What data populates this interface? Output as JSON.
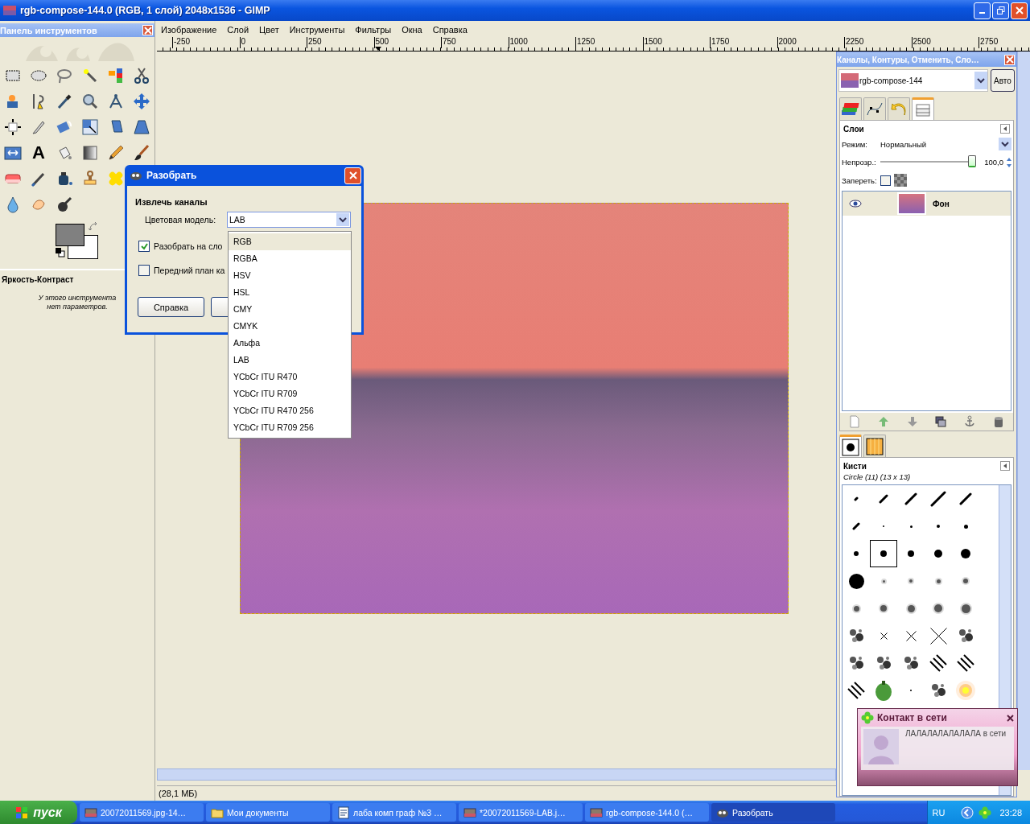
{
  "window": {
    "title": "rgb-compose-144.0 (RGB, 1 слой) 2048x1536 - GIMP"
  },
  "toolbox": {
    "title": "Панель инструментов",
    "text_glyph": "A",
    "options_title": "Яркость-Контраст",
    "options_note": "У этого инструмента нет параметров."
  },
  "menu": [
    "Изображение",
    "Слой",
    "Цвет",
    "Инструменты",
    "Фильтры",
    "Окна",
    "Справка"
  ],
  "ruler": [
    "-250",
    "0",
    "250",
    "500",
    "750",
    "1000",
    "1250",
    "1500",
    "1750",
    "2000",
    "2250",
    "2500",
    "2750"
  ],
  "status_bar": "(28,1 МБ)",
  "dialog": {
    "title": "Разобрать",
    "section": "Извлечь каналы",
    "model_label": "Цветовая модель:",
    "model_value": "LAB",
    "options": [
      {
        "label": "Разобрать на сло",
        "checked": true
      },
      {
        "label": "Передний план ка",
        "checked": false
      }
    ],
    "help_button": "Справка"
  },
  "dropdown": [
    {
      "label": "RGB",
      "highlighted": true
    },
    {
      "label": "RGBA",
      "highlighted": false
    },
    {
      "label": "HSV",
      "highlighted": false
    },
    {
      "label": "HSL",
      "highlighted": false
    },
    {
      "label": "CMY",
      "highlighted": false
    },
    {
      "label": "CMYK",
      "highlighted": false
    },
    {
      "label": "Альфа",
      "highlighted": false
    },
    {
      "label": "LAB",
      "highlighted": false
    },
    {
      "label": "YCbCr ITU R470",
      "highlighted": false
    },
    {
      "label": "YCbCr ITU R709",
      "highlighted": false
    },
    {
      "label": "YCbCr ITU R470 256",
      "highlighted": false
    },
    {
      "label": "YCbCr ITU R709 256",
      "highlighted": false
    }
  ],
  "dock": {
    "title": "Каналы, Контуры, Отменить, Сло…",
    "image": "rgb-compose-144",
    "auto_button": "Авто",
    "tabs": [
      {
        "kind": "channels",
        "selected": false
      },
      {
        "kind": "paths",
        "selected": false
      },
      {
        "kind": "undo",
        "selected": false
      },
      {
        "kind": "layers",
        "selected": true
      }
    ],
    "layers": {
      "title": "Слои",
      "mode_label": "Режим:",
      "mode": "Нормальный",
      "opacity_label": "Непрозр.:",
      "opacity": {
        "level": 1.0,
        "reading": "100,0"
      },
      "lock_label": "Запереть:",
      "lock_checked": false,
      "items": [
        {
          "name": "Фон",
          "visible": true,
          "selected": true
        }
      ]
    },
    "brush_tabs": [
      {
        "kind": "brush",
        "selected": true
      },
      {
        "kind": "pattern",
        "selected": false
      }
    ],
    "brushes_title": "Кисти",
    "brush_current": "Circle (11) (13 x 13)",
    "brushes": [
      {
        "kind": "line",
        "selected": false
      },
      {
        "kind": "line",
        "selected": false
      },
      {
        "kind": "line",
        "selected": false
      },
      {
        "kind": "line",
        "selected": false
      },
      {
        "kind": "line",
        "selected": false
      },
      {
        "kind": "line",
        "selected": false
      },
      {
        "kind": "dot",
        "selected": false
      },
      {
        "kind": "dot",
        "selected": false
      },
      {
        "kind": "dot",
        "selected": false
      },
      {
        "kind": "dot",
        "selected": false
      },
      {
        "kind": "dot",
        "selected": false
      },
      {
        "kind": "dot",
        "selected": true
      },
      {
        "kind": "dot",
        "selected": false
      },
      {
        "kind": "dot",
        "selected": false
      },
      {
        "kind": "dot",
        "selected": false
      },
      {
        "kind": "dot",
        "selected": false
      },
      {
        "kind": "soft",
        "selected": false
      },
      {
        "kind": "soft",
        "selected": false
      },
      {
        "kind": "soft",
        "selected": false
      },
      {
        "kind": "soft",
        "selected": false
      },
      {
        "kind": "soft",
        "selected": false
      },
      {
        "kind": "soft",
        "selected": false
      },
      {
        "kind": "soft",
        "selected": false
      },
      {
        "kind": "soft",
        "selected": false
      },
      {
        "kind": "soft",
        "selected": false
      },
      {
        "kind": "texture",
        "selected": false
      },
      {
        "kind": "cross",
        "selected": false
      },
      {
        "kind": "cross",
        "selected": false
      },
      {
        "kind": "cross",
        "selected": false
      },
      {
        "kind": "texture",
        "selected": false
      },
      {
        "kind": "texture",
        "selected": false
      },
      {
        "kind": "texture",
        "selected": false
      },
      {
        "kind": "texture",
        "selected": false
      },
      {
        "kind": "stripes",
        "selected": false
      },
      {
        "kind": "stripes",
        "selected": false
      },
      {
        "kind": "stripes",
        "selected": false
      },
      {
        "kind": "pepper",
        "selected": false
      },
      {
        "kind": "dot",
        "selected": false
      },
      {
        "kind": "texture",
        "selected": false
      },
      {
        "kind": "sun",
        "selected": false
      }
    ]
  },
  "notification": {
    "title": "Контакт в сети",
    "message": "ЛАЛАЛАЛАЛАЛАЛА в сети"
  },
  "taskbar": {
    "start": "пуск",
    "items": [
      {
        "label": "20072011569.jpg-14…",
        "kind": "image",
        "selected": false
      },
      {
        "label": "Мои документы",
        "kind": "folder",
        "selected": false
      },
      {
        "label": "лаба комп граф №3 …",
        "kind": "document",
        "selected": false
      },
      {
        "label": "*20072011569-LAB.j…",
        "kind": "image",
        "selected": false
      },
      {
        "label": "rgb-compose-144.0 (…",
        "kind": "image",
        "selected": false
      },
      {
        "label": "Разобрать",
        "kind": "gimp",
        "selected": true
      }
    ],
    "language": "RU",
    "clock": "23:28"
  }
}
